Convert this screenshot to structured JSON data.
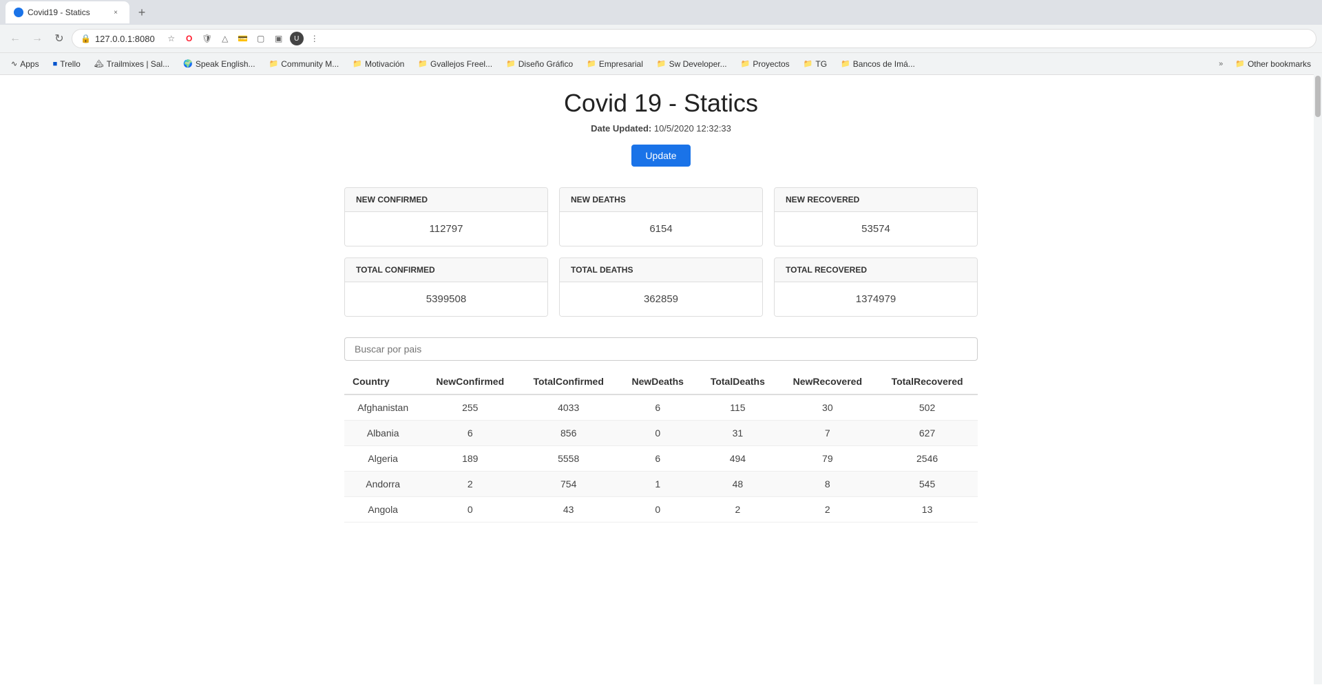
{
  "browser": {
    "tab": {
      "favicon": "●",
      "title": "Covid19 - Statics",
      "close": "×"
    },
    "new_tab": "+",
    "address": "127.0.0.1:8080",
    "nav": {
      "back": "←",
      "forward": "→",
      "reload": "↻",
      "home": "⌂"
    },
    "bookmarks": [
      {
        "label": "Apps",
        "type": "apps"
      },
      {
        "label": "Trello",
        "type": "link"
      },
      {
        "label": "Trailmixes | Sal...",
        "type": "link"
      },
      {
        "label": "Speak English...",
        "type": "link"
      },
      {
        "label": "Community M...",
        "type": "folder"
      },
      {
        "label": "Motivación",
        "type": "folder"
      },
      {
        "label": "Gvallejos Freel...",
        "type": "folder"
      },
      {
        "label": "Diseño Gráfico",
        "type": "folder"
      },
      {
        "label": "Empresarial",
        "type": "folder"
      },
      {
        "label": "Sw Developer...",
        "type": "folder"
      },
      {
        "label": "Proyectos",
        "type": "folder"
      },
      {
        "label": "TG",
        "type": "folder"
      },
      {
        "label": "Bancos de Imá...",
        "type": "folder"
      }
    ],
    "bookmarks_overflow": "»",
    "other_bookmarks": "Other bookmarks"
  },
  "page": {
    "title": "Covid 19 - Statics",
    "date_label": "Date Updated:",
    "date_value": "10/5/2020 12:32:33",
    "update_button": "Update",
    "stats": [
      {
        "label": "NEW CONFIRMED",
        "value": "112797"
      },
      {
        "label": "NEW DEATHS",
        "value": "6154"
      },
      {
        "label": "NEW RECOVERED",
        "value": "53574"
      },
      {
        "label": "TOTAL CONFIRMED",
        "value": "5399508"
      },
      {
        "label": "TOTAL DEATHS",
        "value": "362859"
      },
      {
        "label": "TOTAL RECOVERED",
        "value": "1374979"
      }
    ],
    "search_placeholder": "Buscar por pais",
    "table": {
      "headers": [
        "Country",
        "NewConfirmed",
        "TotalConfirmed",
        "NewDeaths",
        "TotalDeaths",
        "NewRecovered",
        "TotalRecovered"
      ],
      "rows": [
        [
          "Afghanistan",
          "255",
          "4033",
          "6",
          "115",
          "30",
          "502"
        ],
        [
          "Albania",
          "6",
          "856",
          "0",
          "31",
          "7",
          "627"
        ],
        [
          "Algeria",
          "189",
          "5558",
          "6",
          "494",
          "79",
          "2546"
        ],
        [
          "Andorra",
          "2",
          "754",
          "1",
          "48",
          "8",
          "545"
        ],
        [
          "Angola",
          "0",
          "43",
          "0",
          "2",
          "2",
          "13"
        ]
      ]
    }
  }
}
